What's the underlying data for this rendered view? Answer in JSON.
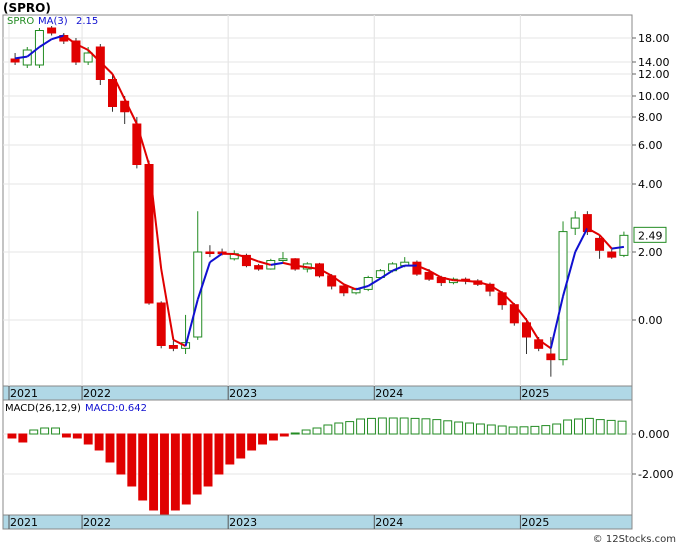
{
  "title": "(SPRO)",
  "watermark": "© 12Stocks.com",
  "colors": {
    "up": "#228b22",
    "down": "#e00000",
    "ma_up": "#1010d0",
    "ma_down": "#e00000",
    "axis_band": "#b0d8e6",
    "price_badge": "#228b22"
  },
  "chart_data": [
    {
      "type": "candlestick",
      "legend": {
        "ticker": "SPRO",
        "ma_label": "MA(3)",
        "ma_value": "2.15"
      },
      "last_price_label": "2.49",
      "y_scale": "log-like",
      "y_ticks": [
        "18.00",
        "14.00",
        "12.00",
        "10.00",
        "8.00",
        "6.00",
        "4.00",
        "2.00",
        "0.00"
      ],
      "x_ticks": [
        "2021",
        "2022",
        "2023",
        "2024",
        "2025"
      ],
      "grid": true,
      "candles": [
        {
          "o": 14.5,
          "h": 15.5,
          "l": 13.5,
          "c": 14.0
        },
        {
          "o": 13.5,
          "h": 16.5,
          "l": 13.0,
          "c": 16.0
        },
        {
          "o": 13.5,
          "h": 20.0,
          "l": 13.0,
          "c": 19.5
        },
        {
          "o": 20.0,
          "h": 20.5,
          "l": 18.5,
          "c": 19.0
        },
        {
          "o": 18.5,
          "h": 19.0,
          "l": 17.0,
          "c": 17.5
        },
        {
          "o": 17.5,
          "h": 18.0,
          "l": 13.5,
          "c": 14.0
        },
        {
          "o": 14.0,
          "h": 16.5,
          "l": 13.5,
          "c": 15.5
        },
        {
          "o": 16.5,
          "h": 17.0,
          "l": 11.0,
          "c": 11.5
        },
        {
          "o": 11.5,
          "h": 12.0,
          "l": 8.5,
          "c": 9.0
        },
        {
          "o": 9.5,
          "h": 10.0,
          "l": 7.5,
          "c": 8.5
        },
        {
          "o": 7.5,
          "h": 8.0,
          "l": 4.8,
          "c": 5.0
        },
        {
          "o": 5.0,
          "h": 5.2,
          "l": 0.45,
          "c": 0.5
        },
        {
          "o": 0.5,
          "h": 0.55,
          "l": -0.5,
          "c": -0.45
        },
        {
          "o": -0.45,
          "h": -0.3,
          "l": -0.55,
          "c": -0.5
        },
        {
          "o": -0.5,
          "h": 0.15,
          "l": -0.6,
          "c": -0.4
        },
        {
          "o": -0.3,
          "h": 3.2,
          "l": -0.35,
          "c": 2.0
        },
        {
          "o": 2.0,
          "h": 2.2,
          "l": 1.85,
          "c": 1.98
        },
        {
          "o": 2.0,
          "h": 2.1,
          "l": 1.9,
          "c": 1.95
        },
        {
          "o": 1.8,
          "h": 2.05,
          "l": 1.75,
          "c": 1.95
        },
        {
          "o": 1.9,
          "h": 1.95,
          "l": 1.55,
          "c": 1.6
        },
        {
          "o": 1.6,
          "h": 1.65,
          "l": 1.45,
          "c": 1.5
        },
        {
          "o": 1.5,
          "h": 1.8,
          "l": 1.48,
          "c": 1.75
        },
        {
          "o": 1.75,
          "h": 2.0,
          "l": 1.7,
          "c": 1.8
        },
        {
          "o": 1.8,
          "h": 1.82,
          "l": 1.45,
          "c": 1.5
        },
        {
          "o": 1.5,
          "h": 1.7,
          "l": 1.4,
          "c": 1.65
        },
        {
          "o": 1.65,
          "h": 1.68,
          "l": 1.25,
          "c": 1.3
        },
        {
          "o": 1.3,
          "h": 1.35,
          "l": 0.9,
          "c": 1.0
        },
        {
          "o": 1.0,
          "h": 1.05,
          "l": 0.7,
          "c": 0.8
        },
        {
          "o": 0.8,
          "h": 0.95,
          "l": 0.75,
          "c": 0.9
        },
        {
          "o": 0.9,
          "h": 1.3,
          "l": 0.85,
          "c": 1.25
        },
        {
          "o": 1.25,
          "h": 1.5,
          "l": 1.2,
          "c": 1.45
        },
        {
          "o": 1.45,
          "h": 1.7,
          "l": 1.4,
          "c": 1.65
        },
        {
          "o": 1.6,
          "h": 1.85,
          "l": 1.55,
          "c": 1.7
        },
        {
          "o": 1.7,
          "h": 1.75,
          "l": 1.3,
          "c": 1.35
        },
        {
          "o": 1.4,
          "h": 1.5,
          "l": 1.15,
          "c": 1.2
        },
        {
          "o": 1.25,
          "h": 1.3,
          "l": 1.0,
          "c": 1.1
        },
        {
          "o": 1.1,
          "h": 1.25,
          "l": 1.05,
          "c": 1.2
        },
        {
          "o": 1.2,
          "h": 1.25,
          "l": 1.05,
          "c": 1.15
        },
        {
          "o": 1.15,
          "h": 1.2,
          "l": 1.0,
          "c": 1.05
        },
        {
          "o": 1.05,
          "h": 1.1,
          "l": 0.7,
          "c": 0.85
        },
        {
          "o": 0.8,
          "h": 0.85,
          "l": 0.3,
          "c": 0.45
        },
        {
          "o": 0.45,
          "h": 0.5,
          "l": -0.1,
          "c": -0.05
        },
        {
          "o": -0.05,
          "h": 0.05,
          "l": -0.6,
          "c": -0.3
        },
        {
          "o": -0.35,
          "h": -0.3,
          "l": -0.55,
          "c": -0.5
        },
        {
          "o": -0.6,
          "h": -0.3,
          "l": -1.0,
          "c": -0.7
        },
        {
          "o": -0.7,
          "h": 2.9,
          "l": -0.8,
          "c": 2.6
        },
        {
          "o": 2.7,
          "h": 3.2,
          "l": 2.5,
          "c": 3.0
        },
        {
          "o": 3.1,
          "h": 3.2,
          "l": 2.5,
          "c": 2.6
        },
        {
          "o": 2.4,
          "h": 2.5,
          "l": 1.8,
          "c": 2.05
        },
        {
          "o": 2.0,
          "h": 2.1,
          "l": 1.8,
          "c": 1.85
        },
        {
          "o": 1.9,
          "h": 2.6,
          "l": 1.85,
          "c": 2.49
        }
      ],
      "ma3": [
        14.6,
        14.9,
        16.5,
        17.8,
        18.5,
        17.0,
        16.0,
        14.0,
        12.0,
        9.7,
        7.5,
        5.0,
        1.5,
        -0.35,
        -0.46,
        0.6,
        1.7,
        1.95,
        1.94,
        1.85,
        1.72,
        1.62,
        1.68,
        1.6,
        1.55,
        1.5,
        1.3,
        1.05,
        0.9,
        1.0,
        1.22,
        1.45,
        1.6,
        1.6,
        1.45,
        1.25,
        1.17,
        1.15,
        1.12,
        1.02,
        0.8,
        0.45,
        0.0,
        -0.35,
        -0.5,
        0.7,
        2.0,
        2.7,
        2.5,
        2.1,
        2.15
      ]
    },
    {
      "type": "bar",
      "legend": {
        "label": "MACD(26,12,9)",
        "value_label": "MACD:0.642"
      },
      "y_ticks": [
        "0.000",
        "-2.000"
      ],
      "x_ticks": [
        "2021",
        "2022",
        "2023",
        "2024",
        "2025"
      ],
      "values": [
        -0.2,
        -0.4,
        0.2,
        0.3,
        0.3,
        -0.15,
        -0.2,
        -0.5,
        -0.8,
        -1.4,
        -2.0,
        -2.6,
        -3.3,
        -3.8,
        -4.0,
        -3.8,
        -3.5,
        -3.0,
        -2.6,
        -2.0,
        -1.5,
        -1.2,
        -0.8,
        -0.5,
        -0.3,
        -0.1,
        0.05,
        0.2,
        0.3,
        0.45,
        0.55,
        0.62,
        0.75,
        0.78,
        0.8,
        0.8,
        0.8,
        0.78,
        0.76,
        0.72,
        0.66,
        0.6,
        0.55,
        0.5,
        0.45,
        0.4,
        0.35,
        0.36,
        0.38,
        0.42,
        0.5,
        0.7,
        0.75,
        0.78,
        0.72,
        0.68,
        0.642
      ]
    }
  ]
}
